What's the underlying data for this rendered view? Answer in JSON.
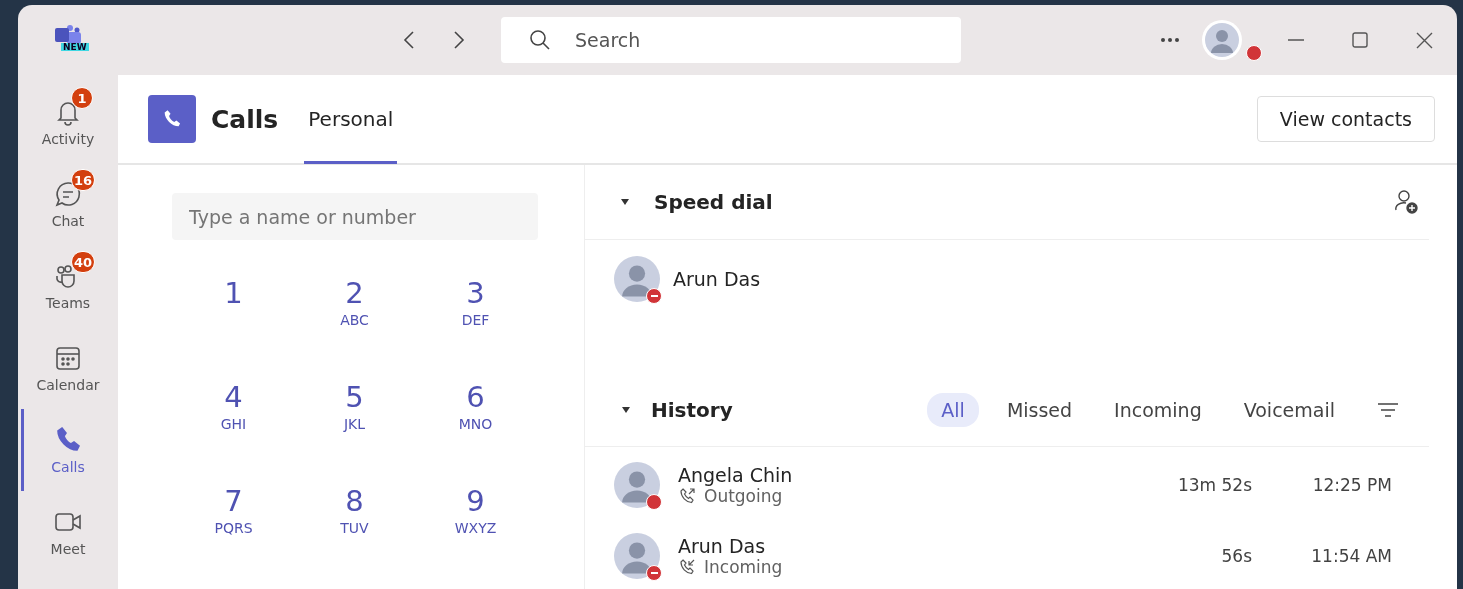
{
  "app_logo": {
    "badge": "NEW"
  },
  "search": {
    "placeholder": "Search"
  },
  "user": {
    "color": "#d13438"
  },
  "sidebar": {
    "items": [
      {
        "kind": "bell",
        "label": "Activity",
        "badge": "1",
        "selected": false
      },
      {
        "kind": "chat",
        "label": "Chat",
        "badge": "16",
        "selected": false
      },
      {
        "kind": "teams",
        "label": "Teams",
        "badge": "40",
        "selected": false
      },
      {
        "kind": "calendar",
        "label": "Calendar",
        "selected": false
      },
      {
        "kind": "phone",
        "label": "Calls",
        "selected": true
      },
      {
        "kind": "video",
        "label": "Meet",
        "selected": false
      }
    ]
  },
  "header": {
    "title": "Calls",
    "tabs": [
      {
        "label": "Personal",
        "selected": true
      }
    ],
    "button": "View contacts"
  },
  "dialer": {
    "placeholder": "Type a name or number",
    "keys": [
      {
        "digit": "1"
      },
      {
        "digit": "2",
        "letters": "ABC"
      },
      {
        "digit": "3",
        "letters": "DEF"
      },
      {
        "digit": "4",
        "letters": "GHI"
      },
      {
        "digit": "5",
        "letters": "JKL"
      },
      {
        "digit": "6",
        "letters": "MNO"
      },
      {
        "digit": "7",
        "letters": "PQRS"
      },
      {
        "digit": "8",
        "letters": "TUV"
      },
      {
        "digit": "9",
        "letters": "WXYZ"
      }
    ]
  },
  "speed_dial": {
    "title": "Speed dial",
    "expanded": true,
    "contacts": [
      {
        "name": "Arun Das",
        "color": "#d13438",
        "dnd": true
      }
    ]
  },
  "history": {
    "title": "History",
    "expanded": true,
    "filters": [
      {
        "label": "All",
        "selected": true
      },
      {
        "label": "Missed",
        "selected": false
      },
      {
        "label": "Incoming",
        "selected": false
      },
      {
        "label": "Voicemail",
        "selected": false
      }
    ],
    "calls": [
      {
        "name": "Angela Chin",
        "color": "#d13438",
        "dnd": false,
        "kind": "outgoing",
        "type": "Outgoing",
        "duration": "13m 52s",
        "time": "12:25 PM"
      },
      {
        "name": "Arun Das",
        "color": "#d13438",
        "dnd": true,
        "kind": "incoming",
        "type": "Incoming",
        "duration": "56s",
        "time": "11:54 AM"
      }
    ]
  }
}
